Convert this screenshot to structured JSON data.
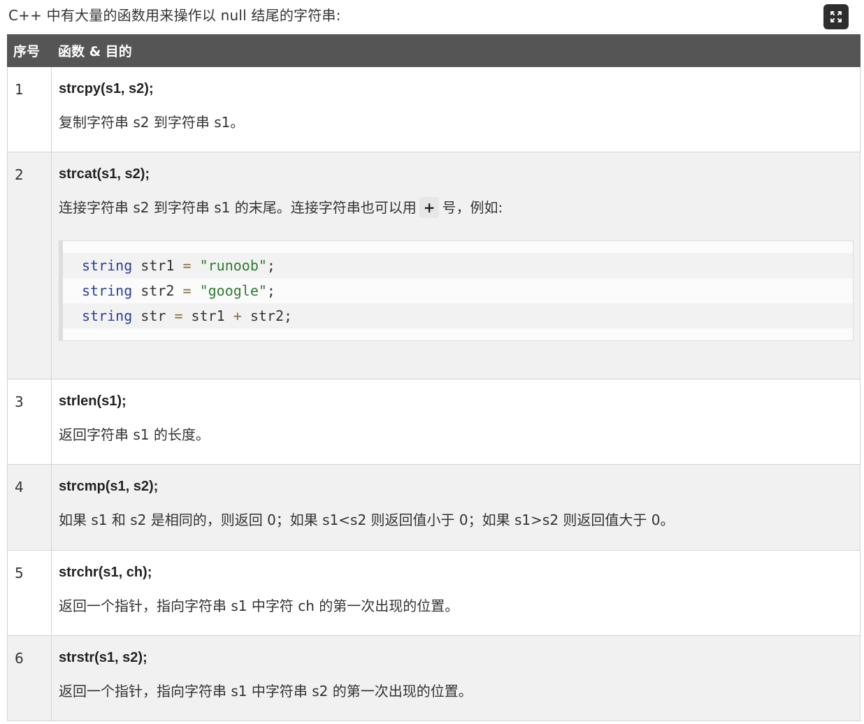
{
  "intro": "C++ 中有大量的函数用来操作以 null 结尾的字符串:",
  "expand_icon": "expand-icon",
  "table": {
    "headers": [
      "序号",
      "函数 & 目的"
    ],
    "rows": [
      {
        "num": "1",
        "fn": "strcpy(s1, s2);",
        "desc": "复制字符串 s2 到字符串 s1。"
      },
      {
        "num": "2",
        "fn": "strcat(s1, s2);",
        "desc_before": "连接字符串 s2 到字符串 s1 的末尾。连接字符串也可以用",
        "desc_code": "+",
        "desc_after": "号，例如:",
        "code": [
          {
            "kw": "string",
            "name": " str1 ",
            "op": "=",
            "str": " \"runoob\"",
            "end": ";"
          },
          {
            "kw": "string",
            "name": " str2 ",
            "op": "=",
            "str": " \"google\"",
            "end": ";"
          },
          {
            "kw": "string",
            "name": " str ",
            "op": "=",
            "rest1": " str1 ",
            "op2": "+",
            "rest2": " str2",
            "end": ";"
          }
        ]
      },
      {
        "num": "3",
        "fn": "strlen(s1);",
        "desc": "返回字符串 s1 的长度。"
      },
      {
        "num": "4",
        "fn": "strcmp(s1, s2);",
        "desc": "如果 s1 和 s2 是相同的，则返回 0；如果 s1<s2 则返回值小于 0；如果 s1>s2 则返回值大于 0。"
      },
      {
        "num": "5",
        "fn": "strchr(s1, ch);",
        "desc": "返回一个指针，指向字符串 s1 中字符 ch 的第一次出现的位置。"
      },
      {
        "num": "6",
        "fn": "strstr(s1, s2);",
        "desc": "返回一个指针，指向字符串 s1 中字符串 s2 的第一次出现的位置。"
      }
    ]
  }
}
